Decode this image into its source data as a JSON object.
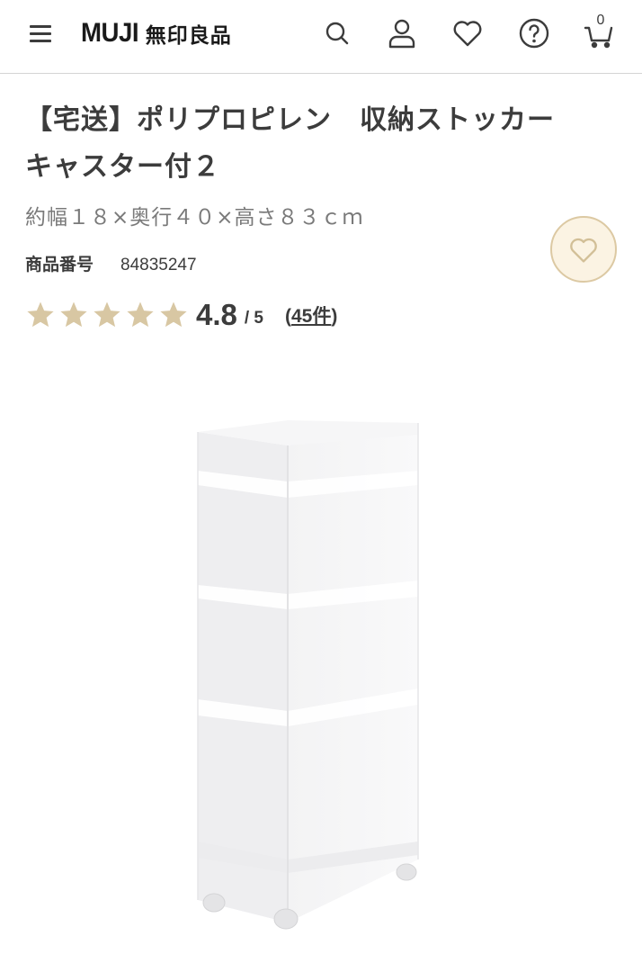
{
  "header": {
    "logo_mark": "MUJI",
    "logo_jp": "無印良品",
    "cart_count": "0"
  },
  "icons": {
    "menu": "hamburger-menu-icon",
    "search": "search-icon",
    "account": "user-icon",
    "favorites": "heart-icon",
    "help": "help-circle-icon",
    "cart": "cart-icon",
    "favorite_button": "heart-icon",
    "rating": "star-icon"
  },
  "product": {
    "title_line1": "【宅送】ポリプロピレン　収納ストッカー",
    "title_line2": "キャスター付２",
    "size": "約幅１８×奥行４０×高さ８３ｃｍ",
    "number_label": "商品番号",
    "number_value": "84835247",
    "rating_value": "4.8",
    "rating_max": "/ 5",
    "review_open": "(",
    "review_count": "45件",
    "review_close": ")",
    "stars": 5
  },
  "colors": {
    "accent_gold": "#d8c7a3",
    "fav_bg": "#fbf3e3",
    "text": "#3c3c3c",
    "muted": "#7a7a7a"
  }
}
